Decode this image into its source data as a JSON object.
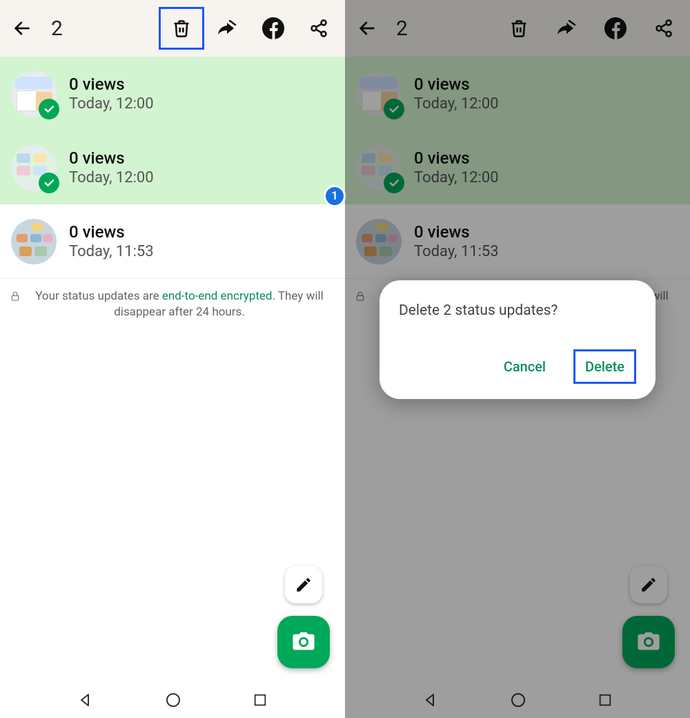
{
  "header": {
    "selection_count": "2"
  },
  "statuses": [
    {
      "views": "0 views",
      "time": "Today, 12:00",
      "selected": true
    },
    {
      "views": "0 views",
      "time": "Today, 12:00",
      "selected": true
    },
    {
      "views": "0 views",
      "time": "Today, 11:53",
      "selected": false
    }
  ],
  "encryption_note": {
    "prefix": "Your status updates are ",
    "link": "end-to-end encrypted",
    "suffix": ". They will disappear after 24 hours."
  },
  "step_badge": "1",
  "dialog": {
    "message": "Delete 2 status updates?",
    "cancel": "Cancel",
    "delete": "Delete"
  },
  "colors": {
    "accent_green": "#00a859",
    "highlight_blue": "#1a57ff",
    "selected_bg": "#d3f4d1"
  }
}
